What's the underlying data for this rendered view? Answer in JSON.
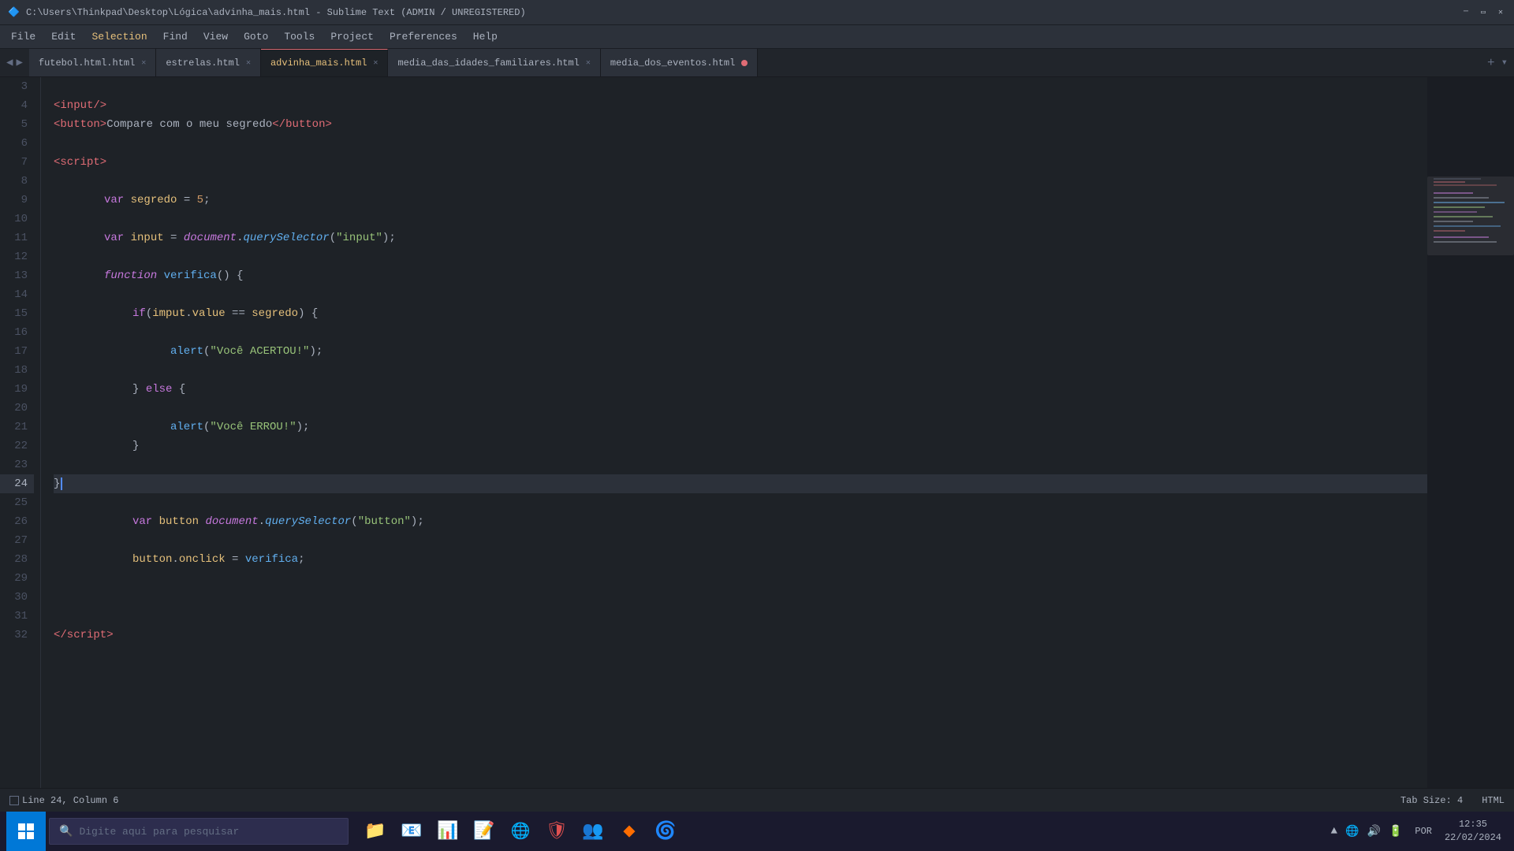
{
  "titlebar": {
    "title": "C:\\Users\\Thinkpad\\Desktop\\Lógica\\advinha_mais.html - Sublime Text (ADMIN / UNREGISTERED)",
    "icon": "🔷"
  },
  "menubar": {
    "items": [
      "File",
      "Edit",
      "Selection",
      "Find",
      "View",
      "Goto",
      "Tools",
      "Project",
      "Preferences",
      "Help"
    ]
  },
  "tabs": [
    {
      "label": "futebol.html.html",
      "active": false,
      "modified": false
    },
    {
      "label": "estrelas.html",
      "active": false,
      "modified": false
    },
    {
      "label": "advinha_mais.html",
      "active": true,
      "modified": false
    },
    {
      "label": "media_das_idades_familiares.html",
      "active": false,
      "modified": false
    },
    {
      "label": "media_dos_eventos.html",
      "active": false,
      "modified": true
    }
  ],
  "statusbar": {
    "position": "Line 24, Column 6",
    "tab_size": "Tab Size: 4",
    "syntax": "HTML"
  },
  "taskbar": {
    "search_placeholder": "Digite aqui para pesquisar",
    "time": "12:35",
    "date": "22/02/2024",
    "language": "POR"
  },
  "lines": [
    {
      "num": 3,
      "content": ""
    },
    {
      "num": 4,
      "content": "input_tag"
    },
    {
      "num": 5,
      "content": "button_tag"
    },
    {
      "num": 6,
      "content": ""
    },
    {
      "num": 7,
      "content": "script_open"
    },
    {
      "num": 8,
      "content": ""
    },
    {
      "num": 9,
      "content": "var_segredo"
    },
    {
      "num": 10,
      "content": ""
    },
    {
      "num": 11,
      "content": "var_input"
    },
    {
      "num": 12,
      "content": ""
    },
    {
      "num": 13,
      "content": "function_verifica"
    },
    {
      "num": 14,
      "content": ""
    },
    {
      "num": 15,
      "content": "if_statement"
    },
    {
      "num": 16,
      "content": ""
    },
    {
      "num": 17,
      "content": "alert_acertou"
    },
    {
      "num": 18,
      "content": ""
    },
    {
      "num": 19,
      "content": "else_block"
    },
    {
      "num": 20,
      "content": ""
    },
    {
      "num": 21,
      "content": "alert_errou"
    },
    {
      "num": 22,
      "content": "close_brace_inner"
    },
    {
      "num": 23,
      "content": ""
    },
    {
      "num": 24,
      "content": "close_brace_fn",
      "active": true
    },
    {
      "num": 25,
      "content": ""
    },
    {
      "num": 26,
      "content": "var_button"
    },
    {
      "num": 27,
      "content": ""
    },
    {
      "num": 28,
      "content": "button_onclick"
    },
    {
      "num": 29,
      "content": ""
    },
    {
      "num": 30,
      "content": ""
    },
    {
      "num": 31,
      "content": ""
    },
    {
      "num": 32,
      "content": "script_close"
    }
  ]
}
